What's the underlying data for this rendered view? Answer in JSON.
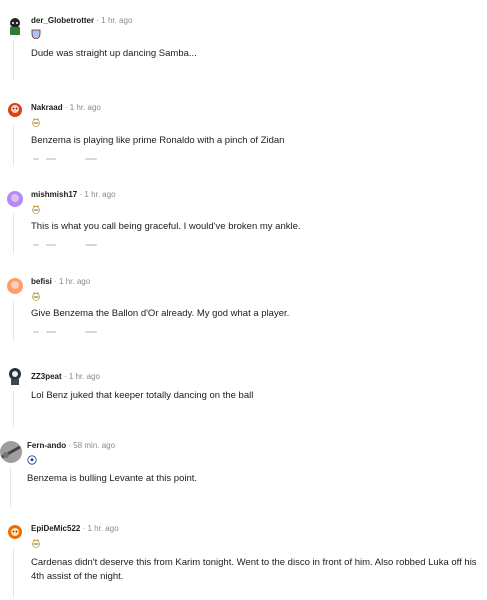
{
  "comments": [
    {
      "username": "der_Globetrotter",
      "time": "1 hr. ago",
      "separator": "·",
      "flair": "villa-crest-icon",
      "avatar_color": "#2e7d32",
      "body": "Dude was straight up dancing Samba..."
    },
    {
      "username": "Nakraad",
      "time": "1 hr. ago",
      "separator": "·",
      "flair": "real-madrid-crest-icon",
      "avatar_color": "#d84315",
      "body": "Benzema is playing like prime Ronaldo with a pinch of Zidan"
    },
    {
      "username": "mishmish17",
      "time": "1 hr. ago",
      "separator": "·",
      "flair": "real-madrid-crest-icon",
      "avatar_color": "#b388ff",
      "body": "This is what you call being graceful. I would've broken my ankle."
    },
    {
      "username": "befisi",
      "time": "1 hr. ago",
      "separator": "·",
      "flair": "real-madrid-crest-icon",
      "avatar_color": "#ff9e6b",
      "body": "Give Benzema the Ballon d'Or already. My god what a player."
    },
    {
      "username": "ZZ3peat",
      "time": "1 hr. ago",
      "separator": "·",
      "flair": "real-madrid-crest-icon",
      "avatar_color": "#263238",
      "body": "Lol Benz juked that keeper totally dancing on the ball"
    },
    {
      "username": "Fern-ando",
      "time": "58 min. ago",
      "separator": "·",
      "flair": "football-icon",
      "avatar_color": "#616161",
      "body": "Benzema is bulling Levante at this point."
    },
    {
      "username": "EpiDeMic522",
      "time": "1 hr. ago",
      "separator": "·",
      "flair": "real-madrid-crest-icon",
      "avatar_color": "#ef6c00",
      "body": "Cardenas didn't deserve this from Karim tonight. Went to the disco in front of him. Also robbed Luka off his 4th assist of the night."
    }
  ]
}
